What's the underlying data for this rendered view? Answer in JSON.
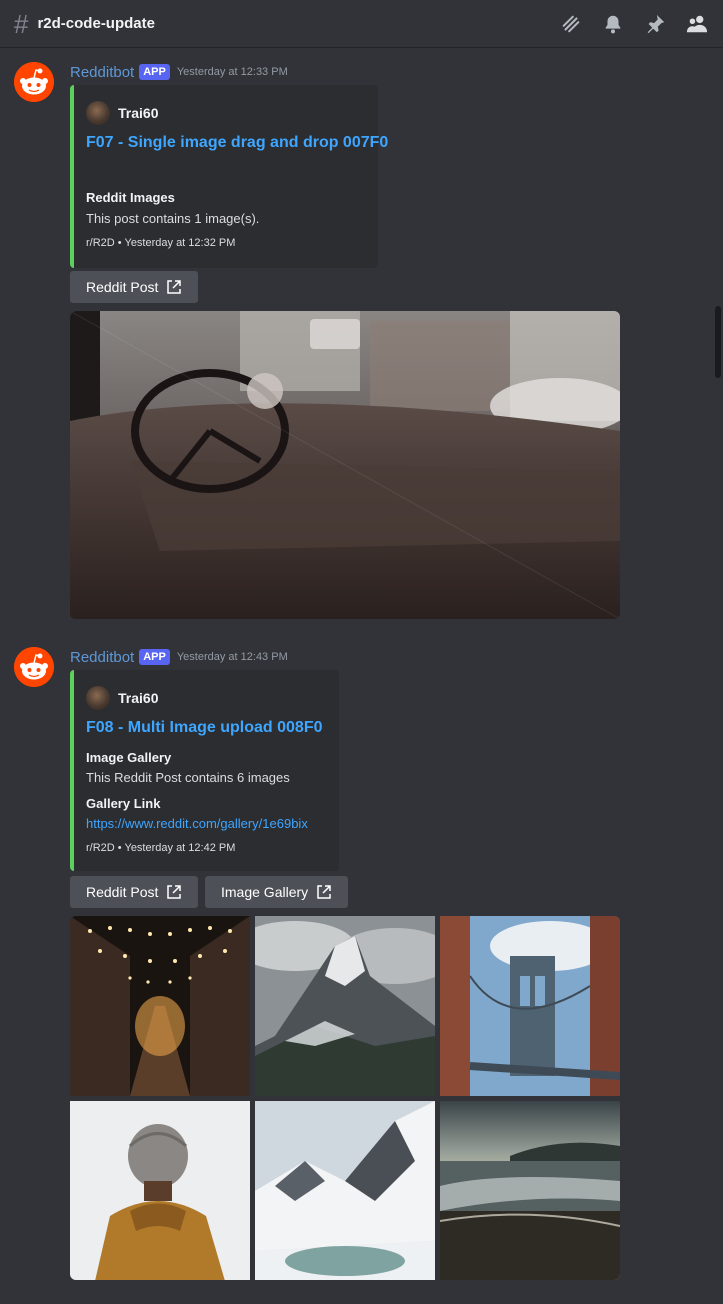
{
  "header": {
    "channel_name": "r2d-code-update",
    "icons": [
      "threads-icon",
      "bell-icon",
      "pin-icon",
      "members-icon"
    ]
  },
  "messages": [
    {
      "author": "Redditbot",
      "tag": "APP",
      "timestamp": "Yesterday at 12:33 PM",
      "embed": {
        "author_name": "Trai60",
        "title": "F07 - Single image drag and drop 007F0",
        "fields": [
          {
            "name": "Reddit Images",
            "value": "This post contains 1 image(s)."
          }
        ],
        "footer": "r/R2D • Yesterday at 12:32 PM"
      },
      "buttons": [
        "Reddit Post"
      ],
      "image_alt": "car interior"
    },
    {
      "author": "Redditbot",
      "tag": "APP",
      "timestamp": "Yesterday at 12:43 PM",
      "embed": {
        "author_name": "Trai60",
        "title": "F08 - Multi Image upload 008F0",
        "fields": [
          {
            "name": "Image Gallery",
            "value": "This Reddit Post contains 6 images"
          },
          {
            "name": "Gallery Link",
            "value": "https://www.reddit.com/gallery/1e69bix"
          }
        ],
        "footer": "r/R2D • Yesterday at 12:42 PM"
      },
      "buttons": [
        "Reddit Post",
        "Image Gallery"
      ],
      "gallery_count": 6
    }
  ],
  "colors": {
    "background": "#313338",
    "embed_bg": "#2b2d31",
    "embed_accent": "#5dcf5c",
    "link": "#3ea6ff",
    "author": "#5e98d6",
    "app_tag": "#5865f2",
    "button": "#4e5058",
    "reddit_orange": "#ff4500"
  }
}
